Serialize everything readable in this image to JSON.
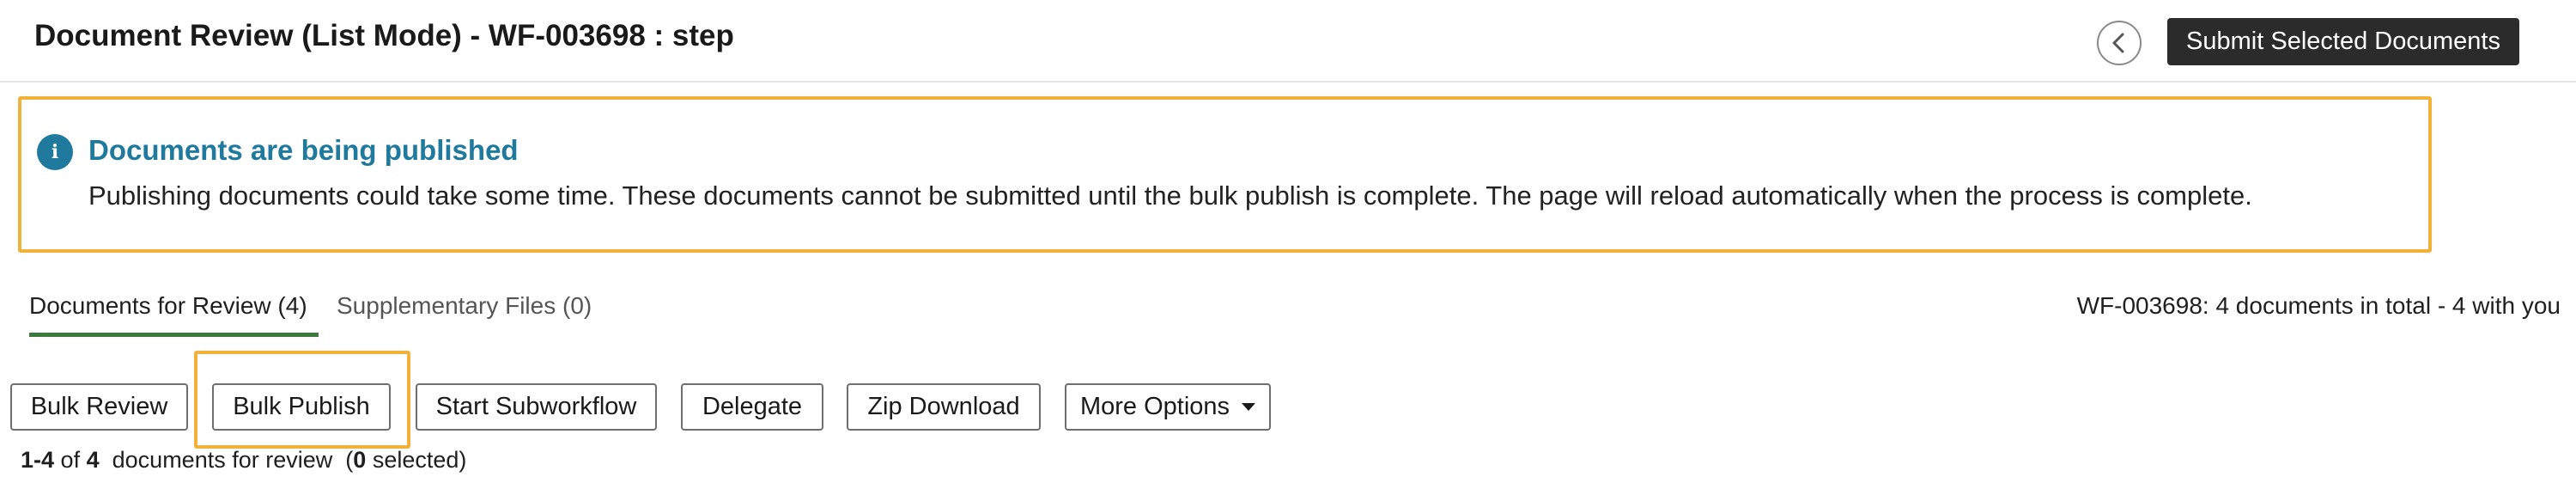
{
  "header": {
    "title": "Document Review (List Mode) - WF-003698 : step",
    "back_icon": "chevron-left-icon",
    "submit_label": "Submit Selected Documents"
  },
  "notice": {
    "icon": "info-icon",
    "icon_glyph": "i",
    "title": "Documents are being published",
    "text": "Publishing documents could take some time. These documents cannot be submitted until the bulk publish is complete. The page will reload automatically when the process is complete."
  },
  "tabs": [
    {
      "label": "Documents for Review (4)",
      "active": true
    },
    {
      "label": "Supplementary Files (0)",
      "active": false
    }
  ],
  "summary": "WF-003698: 4 documents in total - 4 with you",
  "actions": {
    "bulk_review": "Bulk Review",
    "bulk_publish": "Bulk Publish",
    "start_subworkflow": "Start Subworkflow",
    "delegate": "Delegate",
    "zip_download": "Zip Download",
    "more_options": "More Options"
  },
  "count": {
    "range": "1-4",
    "of_word": "of",
    "total": "4",
    "suffix": "documents for review",
    "selected_open": "(",
    "selected": "0",
    "selected_close": "selected)"
  },
  "colors": {
    "accent": "#1f7a9e",
    "highlight": "#f0b23a",
    "tab_underline": "#3d7a3d",
    "primary_button": "#2b2b2b"
  }
}
